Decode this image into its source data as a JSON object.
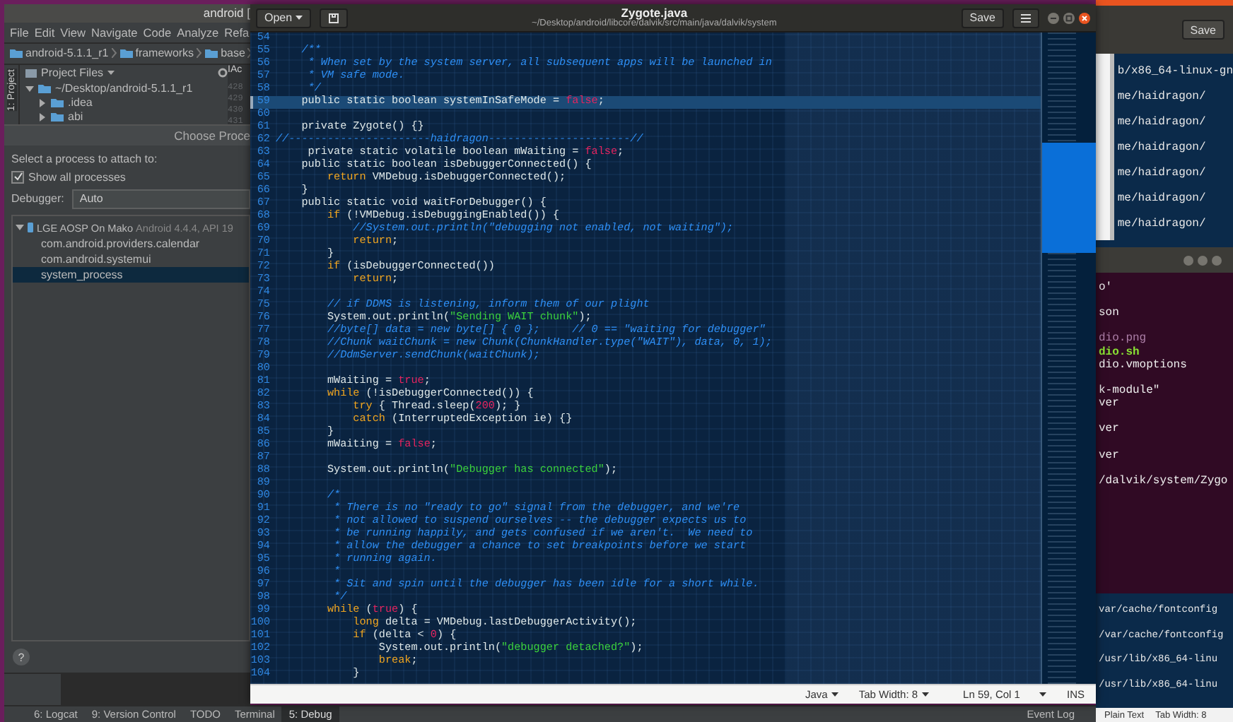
{
  "ide_window": {
    "title": "android [",
    "menu": [
      "File",
      "Edit",
      "View",
      "Navigate",
      "Code",
      "Analyze",
      "Refa"
    ],
    "breadcrumb": [
      "android-5.1.1_r1",
      "frameworks",
      "base"
    ],
    "side_tab": "1: Project",
    "project_panel": {
      "title": "Project Files",
      "tree": [
        {
          "label": "~/Desktop/android-5.1.1_r1",
          "expanded": true,
          "children": [
            {
              "label": ".idea",
              "expanded": false
            },
            {
              "label": "abi",
              "expanded": false
            }
          ]
        }
      ]
    },
    "editor_tab": "IAc",
    "line_numbers": [
      "428",
      "429",
      "430",
      "431"
    ],
    "bottom_tabs": [
      {
        "label": "6: Logcat",
        "selected": false
      },
      {
        "label": "9: Version Control",
        "selected": false
      },
      {
        "label": "TODO",
        "selected": false
      },
      {
        "label": "Terminal",
        "selected": false
      },
      {
        "label": "5: Debug",
        "selected": true
      }
    ],
    "event_log": "Event Log"
  },
  "attach_dialog": {
    "title": "Choose Proce",
    "prompt": "Select a process to attach to:",
    "show_all": {
      "label": "Show all processes",
      "checked": true
    },
    "debugger": {
      "label": "Debugger:",
      "value": "Auto"
    },
    "devices": [
      {
        "name": "LGE AOSP On Mako",
        "detail": "Android 4.4.4, API 19",
        "expanded": true,
        "processes": [
          {
            "name": "com.android.providers.calendar",
            "selected": false
          },
          {
            "name": "com.android.systemui",
            "selected": false
          },
          {
            "name": "system_process",
            "selected": true
          }
        ]
      }
    ],
    "help": "?"
  },
  "editor_window": {
    "open_button": "Open",
    "title": "Zygote.java",
    "path": "~/Desktop/android/libcore/dalvik/src/main/java/dalvik/system",
    "save_button": "Save",
    "lines": [
      {
        "number": "54",
        "highlighted": false
      },
      {
        "number": "55",
        "highlighted": false,
        "tokens": [
          {
            "kind": "comment",
            "text": "    /**"
          }
        ]
      },
      {
        "number": "56",
        "highlighted": false,
        "tokens": [
          {
            "kind": "comment",
            "text": "     * When set by the system server, all subsequent apps will be launched in"
          }
        ]
      },
      {
        "number": "57",
        "highlighted": false,
        "tokens": [
          {
            "kind": "comment",
            "text": "     * VM safe mode."
          }
        ]
      },
      {
        "number": "58",
        "highlighted": false,
        "tokens": [
          {
            "kind": "comment",
            "text": "     */"
          }
        ]
      },
      {
        "number": "59",
        "highlighted": true,
        "tokens": [
          {
            "kind": "plain",
            "text": "    public static boolean systemInSafeMode = "
          },
          {
            "kind": "literal",
            "text": "false"
          },
          {
            "kind": "plain",
            "text": ";"
          }
        ]
      },
      {
        "number": "60",
        "highlighted": false
      },
      {
        "number": "61",
        "highlighted": false,
        "tokens": [
          {
            "kind": "plain",
            "text": "    private Zygote() {}"
          }
        ]
      },
      {
        "number": "62",
        "highlighted": false,
        "tokens": [
          {
            "kind": "comment",
            "text": "//----------------------haidragon----------------------//"
          }
        ]
      },
      {
        "number": "63",
        "highlighted": false,
        "tokens": [
          {
            "kind": "plain",
            "text": "     private static volatile boolean mWaiting = "
          },
          {
            "kind": "literal",
            "text": "false"
          },
          {
            "kind": "plain",
            "text": ";"
          }
        ]
      },
      {
        "number": "64",
        "highlighted": false,
        "tokens": [
          {
            "kind": "plain",
            "text": "    public static boolean isDebuggerConnected() {"
          }
        ]
      },
      {
        "number": "65",
        "highlighted": false,
        "tokens": [
          {
            "kind": "keyword",
            "text": "        return"
          },
          {
            "kind": "plain",
            "text": " VMDebug.isDebuggerConnected();"
          }
        ]
      },
      {
        "number": "66",
        "highlighted": false,
        "tokens": [
          {
            "kind": "plain",
            "text": "    }"
          }
        ]
      },
      {
        "number": "67",
        "highlighted": false,
        "tokens": [
          {
            "kind": "plain",
            "text": "    public static void waitForDebugger() {"
          }
        ]
      },
      {
        "number": "68",
        "highlighted": false,
        "tokens": [
          {
            "kind": "keyword",
            "text": "        if"
          },
          {
            "kind": "plain",
            "text": " (!VMDebug.isDebuggingEnabled()) {"
          }
        ]
      },
      {
        "number": "69",
        "highlighted": false,
        "tokens": [
          {
            "kind": "comment",
            "text": "            //System.out.println(\"debugging not enabled, not waiting\");"
          }
        ]
      },
      {
        "number": "70",
        "highlighted": false,
        "tokens": [
          {
            "kind": "keyword",
            "text": "            return"
          },
          {
            "kind": "plain",
            "text": ";"
          }
        ]
      },
      {
        "number": "71",
        "highlighted": false,
        "tokens": [
          {
            "kind": "plain",
            "text": "        }"
          }
        ]
      },
      {
        "number": "72",
        "highlighted": false,
        "tokens": [
          {
            "kind": "keyword",
            "text": "        if"
          },
          {
            "kind": "plain",
            "text": " (isDebuggerConnected())"
          }
        ]
      },
      {
        "number": "73",
        "highlighted": false,
        "tokens": [
          {
            "kind": "keyword",
            "text": "            return"
          },
          {
            "kind": "plain",
            "text": ";"
          }
        ]
      },
      {
        "number": "74",
        "highlighted": false
      },
      {
        "number": "75",
        "highlighted": false,
        "tokens": [
          {
            "kind": "comment",
            "text": "        // if DDMS is listening, inform them of our plight"
          }
        ]
      },
      {
        "number": "76",
        "highlighted": false,
        "tokens": [
          {
            "kind": "plain",
            "text": "        System.out.println("
          },
          {
            "kind": "string",
            "text": "\"Sending WAIT chunk\""
          },
          {
            "kind": "plain",
            "text": ");"
          }
        ]
      },
      {
        "number": "77",
        "highlighted": false,
        "tokens": [
          {
            "kind": "comment",
            "text": "        //byte[] data = new byte[] { 0 };     // 0 == \"waiting for debugger\""
          }
        ]
      },
      {
        "number": "78",
        "highlighted": false,
        "tokens": [
          {
            "kind": "comment",
            "text": "        //Chunk waitChunk = new Chunk(ChunkHandler.type(\"WAIT\"), data, 0, 1);"
          }
        ]
      },
      {
        "number": "79",
        "highlighted": false,
        "tokens": [
          {
            "kind": "comment",
            "text": "        //DdmServer.sendChunk(waitChunk);"
          }
        ]
      },
      {
        "number": "80",
        "highlighted": false
      },
      {
        "number": "81",
        "highlighted": false,
        "tokens": [
          {
            "kind": "plain",
            "text": "        mWaiting = "
          },
          {
            "kind": "literal",
            "text": "true"
          },
          {
            "kind": "plain",
            "text": ";"
          }
        ]
      },
      {
        "number": "82",
        "highlighted": false,
        "tokens": [
          {
            "kind": "keyword",
            "text": "        while"
          },
          {
            "kind": "plain",
            "text": " (!isDebuggerConnected()) {"
          }
        ]
      },
      {
        "number": "83",
        "highlighted": false,
        "tokens": [
          {
            "kind": "keyword",
            "text": "            try"
          },
          {
            "kind": "plain",
            "text": " { Thread.sleep("
          },
          {
            "kind": "literal",
            "text": "200"
          },
          {
            "kind": "plain",
            "text": "); }"
          }
        ]
      },
      {
        "number": "84",
        "highlighted": false,
        "tokens": [
          {
            "kind": "keyword",
            "text": "            catch"
          },
          {
            "kind": "plain",
            "text": " (InterruptedException ie) {}"
          }
        ]
      },
      {
        "number": "85",
        "highlighted": false,
        "tokens": [
          {
            "kind": "plain",
            "text": "        }"
          }
        ]
      },
      {
        "number": "86",
        "highlighted": false,
        "tokens": [
          {
            "kind": "plain",
            "text": "        mWaiting = "
          },
          {
            "kind": "literal",
            "text": "false"
          },
          {
            "kind": "plain",
            "text": ";"
          }
        ]
      },
      {
        "number": "87",
        "highlighted": false
      },
      {
        "number": "88",
        "highlighted": false,
        "tokens": [
          {
            "kind": "plain",
            "text": "        System.out.println("
          },
          {
            "kind": "string",
            "text": "\"Debugger has connected\""
          },
          {
            "kind": "plain",
            "text": ");"
          }
        ]
      },
      {
        "number": "89",
        "highlighted": false
      },
      {
        "number": "90",
        "highlighted": false,
        "tokens": [
          {
            "kind": "comment",
            "text": "        /*"
          }
        ]
      },
      {
        "number": "91",
        "highlighted": false,
        "tokens": [
          {
            "kind": "comment",
            "text": "         * There is no \"ready to go\" signal from the debugger, and we're"
          }
        ]
      },
      {
        "number": "92",
        "highlighted": false,
        "tokens": [
          {
            "kind": "comment",
            "text": "         * not allowed to suspend ourselves -- the debugger expects us to"
          }
        ]
      },
      {
        "number": "93",
        "highlighted": false,
        "tokens": [
          {
            "kind": "comment",
            "text": "         * be running happily, and gets confused if we aren't.  We need to"
          }
        ]
      },
      {
        "number": "94",
        "highlighted": false,
        "tokens": [
          {
            "kind": "comment",
            "text": "         * allow the debugger a chance to set breakpoints before we start"
          }
        ]
      },
      {
        "number": "95",
        "highlighted": false,
        "tokens": [
          {
            "kind": "comment",
            "text": "         * running again."
          }
        ]
      },
      {
        "number": "96",
        "highlighted": false,
        "tokens": [
          {
            "kind": "comment",
            "text": "         *"
          }
        ]
      },
      {
        "number": "97",
        "highlighted": false,
        "tokens": [
          {
            "kind": "comment",
            "text": "         * Sit and spin until the debugger has been idle for a short while."
          }
        ]
      },
      {
        "number": "98",
        "highlighted": false,
        "tokens": [
          {
            "kind": "comment",
            "text": "         */"
          }
        ]
      },
      {
        "number": "99",
        "highlighted": false,
        "tokens": [
          {
            "kind": "keyword",
            "text": "        while"
          },
          {
            "kind": "plain",
            "text": " ("
          },
          {
            "kind": "literal",
            "text": "true"
          },
          {
            "kind": "plain",
            "text": ") {"
          }
        ]
      },
      {
        "number": "100",
        "highlighted": false,
        "tokens": [
          {
            "kind": "keyword",
            "text": "            long"
          },
          {
            "kind": "plain",
            "text": " delta = VMDebug.lastDebuggerActivity();"
          }
        ]
      },
      {
        "number": "101",
        "highlighted": false,
        "tokens": [
          {
            "kind": "keyword",
            "text": "            if"
          },
          {
            "kind": "plain",
            "text": " (delta < "
          },
          {
            "kind": "literal",
            "text": "0"
          },
          {
            "kind": "plain",
            "text": ") {"
          }
        ]
      },
      {
        "number": "102",
        "highlighted": false,
        "tokens": [
          {
            "kind": "plain",
            "text": "                System.out.println("
          },
          {
            "kind": "string",
            "text": "\"debugger detached?\""
          },
          {
            "kind": "plain",
            "text": ");"
          }
        ]
      },
      {
        "number": "103",
        "highlighted": false,
        "tokens": [
          {
            "kind": "keyword",
            "text": "                break"
          },
          {
            "kind": "plain",
            "text": ";"
          }
        ]
      },
      {
        "number": "104",
        "highlighted": false,
        "tokens": [
          {
            "kind": "plain",
            "text": "            }"
          }
        ]
      }
    ],
    "status_bar": {
      "language": "Java",
      "tab_width": "Tab Width: 8",
      "position": "Ln 59, Col 1",
      "mode": "INS"
    }
  },
  "background_windows": {
    "save_button": "Save",
    "terminal_lines": [
      "b/x86_64-linux-gn",
      "me/haidragon/",
      "me/haidragon/",
      "me/haidragon/",
      "me/haidragon/",
      "me/haidragon/",
      "me/haidragon/"
    ],
    "purple_terminal_lines": [
      {
        "text": "o'",
        "kind": "plain"
      },
      {
        "text": "son",
        "kind": "plain"
      },
      {
        "text": "dio.png",
        "kind": "image"
      },
      {
        "text": "dio.sh",
        "kind": "executable"
      },
      {
        "text": "dio.vmoptions",
        "kind": "plain"
      },
      {
        "text": "k-module\"",
        "kind": "plain"
      },
      {
        "text": "ver",
        "kind": "plain"
      },
      {
        "text": "ver",
        "kind": "plain"
      },
      {
        "text": "ver",
        "kind": "plain"
      },
      {
        "text": "/dalvik/system/Zygo",
        "kind": "plain"
      }
    ],
    "lower_terminal_lines": [
      "var/cache/fontconfig",
      "/var/cache/fontconfig",
      "/usr/lib/x86_64-linu",
      "/usr/lib/x86_64-linu"
    ],
    "status_bar": [
      "Plain Text",
      "Tab Width: 8"
    ]
  }
}
